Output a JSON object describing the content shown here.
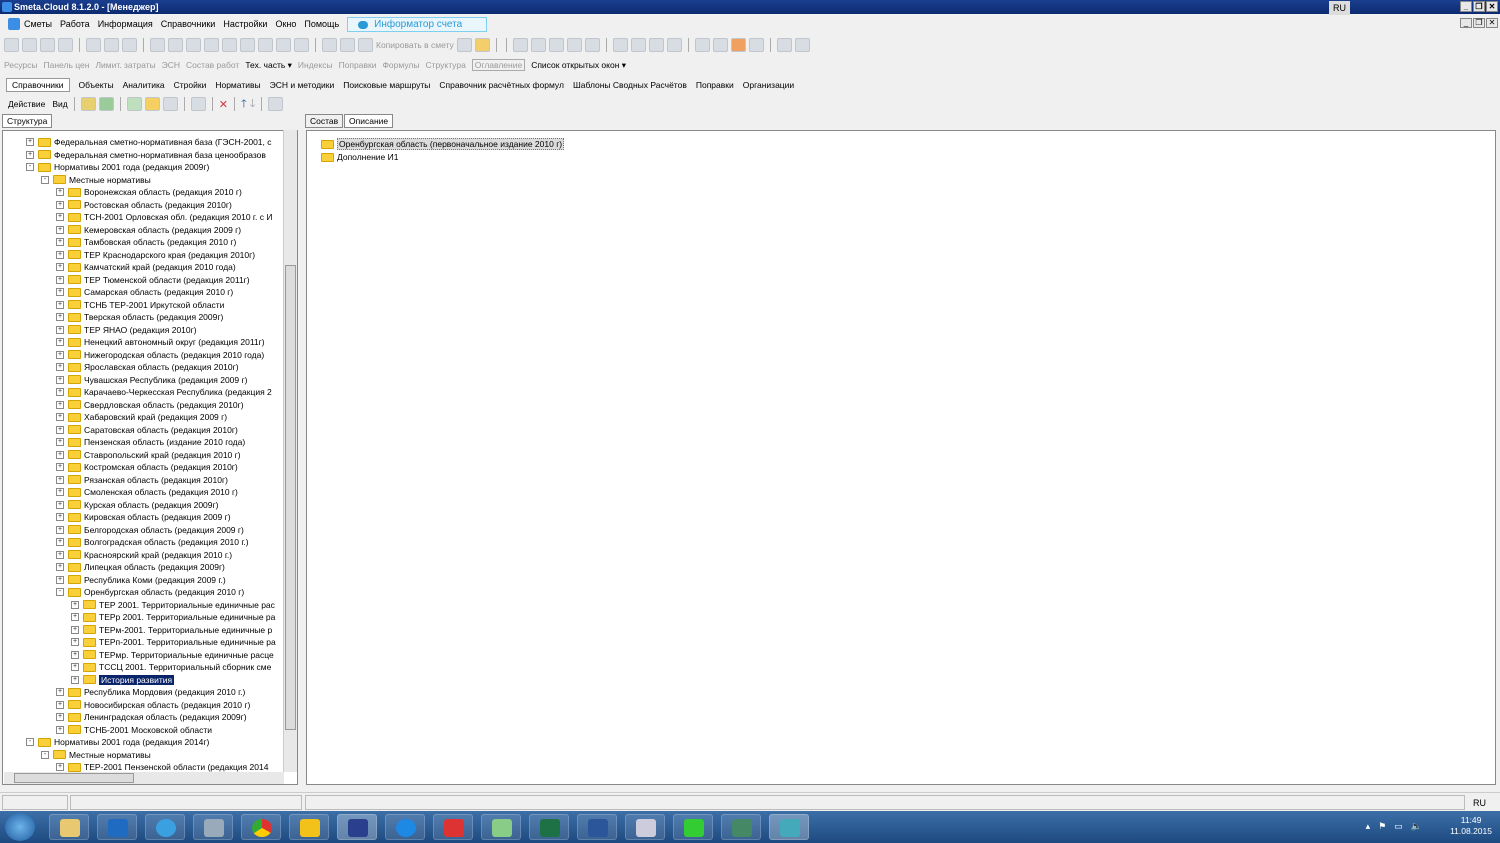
{
  "title": "Smeta.Cloud  8.1.2.0  - [Менеджер]",
  "lang": "RU",
  "menu": [
    "Сметы",
    "Работа",
    "Информация",
    "Справочники",
    "Настройки",
    "Окно",
    "Помощь"
  ],
  "informer": "Информатор счета",
  "toolbar1": {
    "copy_to_estimate": "Копировать в смету"
  },
  "toolbar2": {
    "items": [
      "Ресурсы",
      "Панель цен",
      "Лимит. затраты",
      "ЭСН",
      "Состав работ"
    ],
    "tech": "Тех. часть ▾",
    "items2": [
      "Индексы",
      "Поправки",
      "Формулы",
      "Структура",
      "Оглавление"
    ],
    "open_windows": "Список открытых окон ▾"
  },
  "tabs": [
    "Справочники",
    "Объекты",
    "Аналитика",
    "Стройки",
    "Нормативы",
    "ЭСН и методики",
    "Поисковые маршруты",
    "Справочник расчётных формул",
    "Шаблоны Сводных Расчётов",
    "Поправки",
    "Организации"
  ],
  "actionbar": {
    "action": "Действие",
    "view": "Вид"
  },
  "left_tab": "Структура",
  "right_tabs": [
    "Состав",
    "Описание"
  ],
  "tree": [
    {
      "l": 1,
      "e": "+",
      "t": "Федеральная сметно-нормативная база (ГЭСН-2001, с"
    },
    {
      "l": 1,
      "e": "+",
      "t": "Федеральная сметно-нормативная база ценообразов"
    },
    {
      "l": 1,
      "e": "-",
      "t": "Нормативы 2001 года (редакция 2009г)"
    },
    {
      "l": 2,
      "e": "-",
      "t": "Местные нормативы"
    },
    {
      "l": 3,
      "e": "+",
      "t": "Воронежская область (редакция 2010 г)"
    },
    {
      "l": 3,
      "e": "+",
      "t": "Ростовская область (редакция 2010г)"
    },
    {
      "l": 3,
      "e": "+",
      "t": "ТСН-2001 Орловская обл. (редакция 2010 г. с И"
    },
    {
      "l": 3,
      "e": "+",
      "t": "Кемеровская область (редакция 2009 г)"
    },
    {
      "l": 3,
      "e": "+",
      "t": "Тамбовская область (редакция 2010 г)"
    },
    {
      "l": 3,
      "e": "+",
      "t": "ТЕР Краснодарского края (редакция 2010г)"
    },
    {
      "l": 3,
      "e": "+",
      "t": "Камчатский край (редакция 2010 года)"
    },
    {
      "l": 3,
      "e": "+",
      "t": "ТЕР Тюменской области (редакция 2011г)"
    },
    {
      "l": 3,
      "e": "+",
      "t": "Самарская область (редакция 2010 г)"
    },
    {
      "l": 3,
      "e": "+",
      "t": "ТСНБ ТЕР-2001 Иркутской области"
    },
    {
      "l": 3,
      "e": "+",
      "t": "Тверская область (редакция 2009г)"
    },
    {
      "l": 3,
      "e": "+",
      "t": "ТЕР ЯНАО (редакция 2010г)"
    },
    {
      "l": 3,
      "e": "+",
      "t": "Ненецкий автономный округ (редакция 2011г)"
    },
    {
      "l": 3,
      "e": "+",
      "t": "Нижегородская область (редакция 2010 года)"
    },
    {
      "l": 3,
      "e": "+",
      "t": "Ярославская область (редакция 2010г)"
    },
    {
      "l": 3,
      "e": "+",
      "t": "Чувашская Республика (редакция 2009 г)"
    },
    {
      "l": 3,
      "e": "+",
      "t": "Карачаево-Черкесская Республика (редакция 2"
    },
    {
      "l": 3,
      "e": "+",
      "t": "Свердловская область (редакция 2010г)"
    },
    {
      "l": 3,
      "e": "+",
      "t": "Хабаровский край (редакция 2009 г)"
    },
    {
      "l": 3,
      "e": "+",
      "t": "Саратовская область (редакция 2010г)"
    },
    {
      "l": 3,
      "e": "+",
      "t": "Пензенская область (издание 2010 года)"
    },
    {
      "l": 3,
      "e": "+",
      "t": "Ставропольский край (редакция 2010 г)"
    },
    {
      "l": 3,
      "e": "+",
      "t": "Костромская область (редакция 2010г)"
    },
    {
      "l": 3,
      "e": "+",
      "t": "Рязанская область (редакция 2010г)"
    },
    {
      "l": 3,
      "e": "+",
      "t": "Смоленская область (редакция 2010 г)"
    },
    {
      "l": 3,
      "e": "+",
      "t": "Курская область (редакция 2009г)"
    },
    {
      "l": 3,
      "e": "+",
      "t": "Кировская область (редакция 2009 г)"
    },
    {
      "l": 3,
      "e": "+",
      "t": "Белгородская область (редакция 2009 г)"
    },
    {
      "l": 3,
      "e": "+",
      "t": "Волгоградская область (редакция 2010 г.)"
    },
    {
      "l": 3,
      "e": "+",
      "t": "Красноярский край (редакция 2010 г.)"
    },
    {
      "l": 3,
      "e": "+",
      "t": "Липецкая область (редакция 2009г)"
    },
    {
      "l": 3,
      "e": "+",
      "t": "Республика Коми (редакция 2009 г.)"
    },
    {
      "l": 3,
      "e": "-",
      "t": "Оренбургская область (редакция 2010 г)"
    },
    {
      "l": 4,
      "e": "+",
      "t": "ТЕР 2001. Территориальные единичные рас"
    },
    {
      "l": 4,
      "e": "+",
      "t": "ТЕРр 2001. Территориальные единичные ра"
    },
    {
      "l": 4,
      "e": "+",
      "t": "ТЕРм-2001. Территориальные единичные р"
    },
    {
      "l": 4,
      "e": "+",
      "t": "ТЕРп-2001. Территориальные единичные ра"
    },
    {
      "l": 4,
      "e": "+",
      "t": "ТЕРмр. Территориальные единичные расце"
    },
    {
      "l": 4,
      "e": "+",
      "t": "ТССЦ 2001. Территориальный сборник сме"
    },
    {
      "l": 4,
      "e": "+",
      "t": "История развития",
      "sel": true
    },
    {
      "l": 3,
      "e": "+",
      "t": "Республика Мордовия (редакция 2010 г.)"
    },
    {
      "l": 3,
      "e": "+",
      "t": "Новосибирская область (редакция 2010 г)"
    },
    {
      "l": 3,
      "e": "+",
      "t": "Ленинградская область (редакция 2009г)"
    },
    {
      "l": 3,
      "e": "+",
      "t": "ТСНБ-2001 Московской области"
    },
    {
      "l": 1,
      "e": "-",
      "t": "Нормативы 2001 года (редакция 2014г)"
    },
    {
      "l": 2,
      "e": "-",
      "t": "Местные нормативы"
    },
    {
      "l": 3,
      "e": "+",
      "t": "ТЕР-2001 Пензенской области (редакция 2014"
    }
  ],
  "right_list": [
    "Оренбургская область (первоначальное издание 2010 г)",
    "Дополнение И1"
  ],
  "status": {
    "lang": "RU"
  },
  "tray": {
    "time": "11:49",
    "date": "11.08.2015"
  }
}
